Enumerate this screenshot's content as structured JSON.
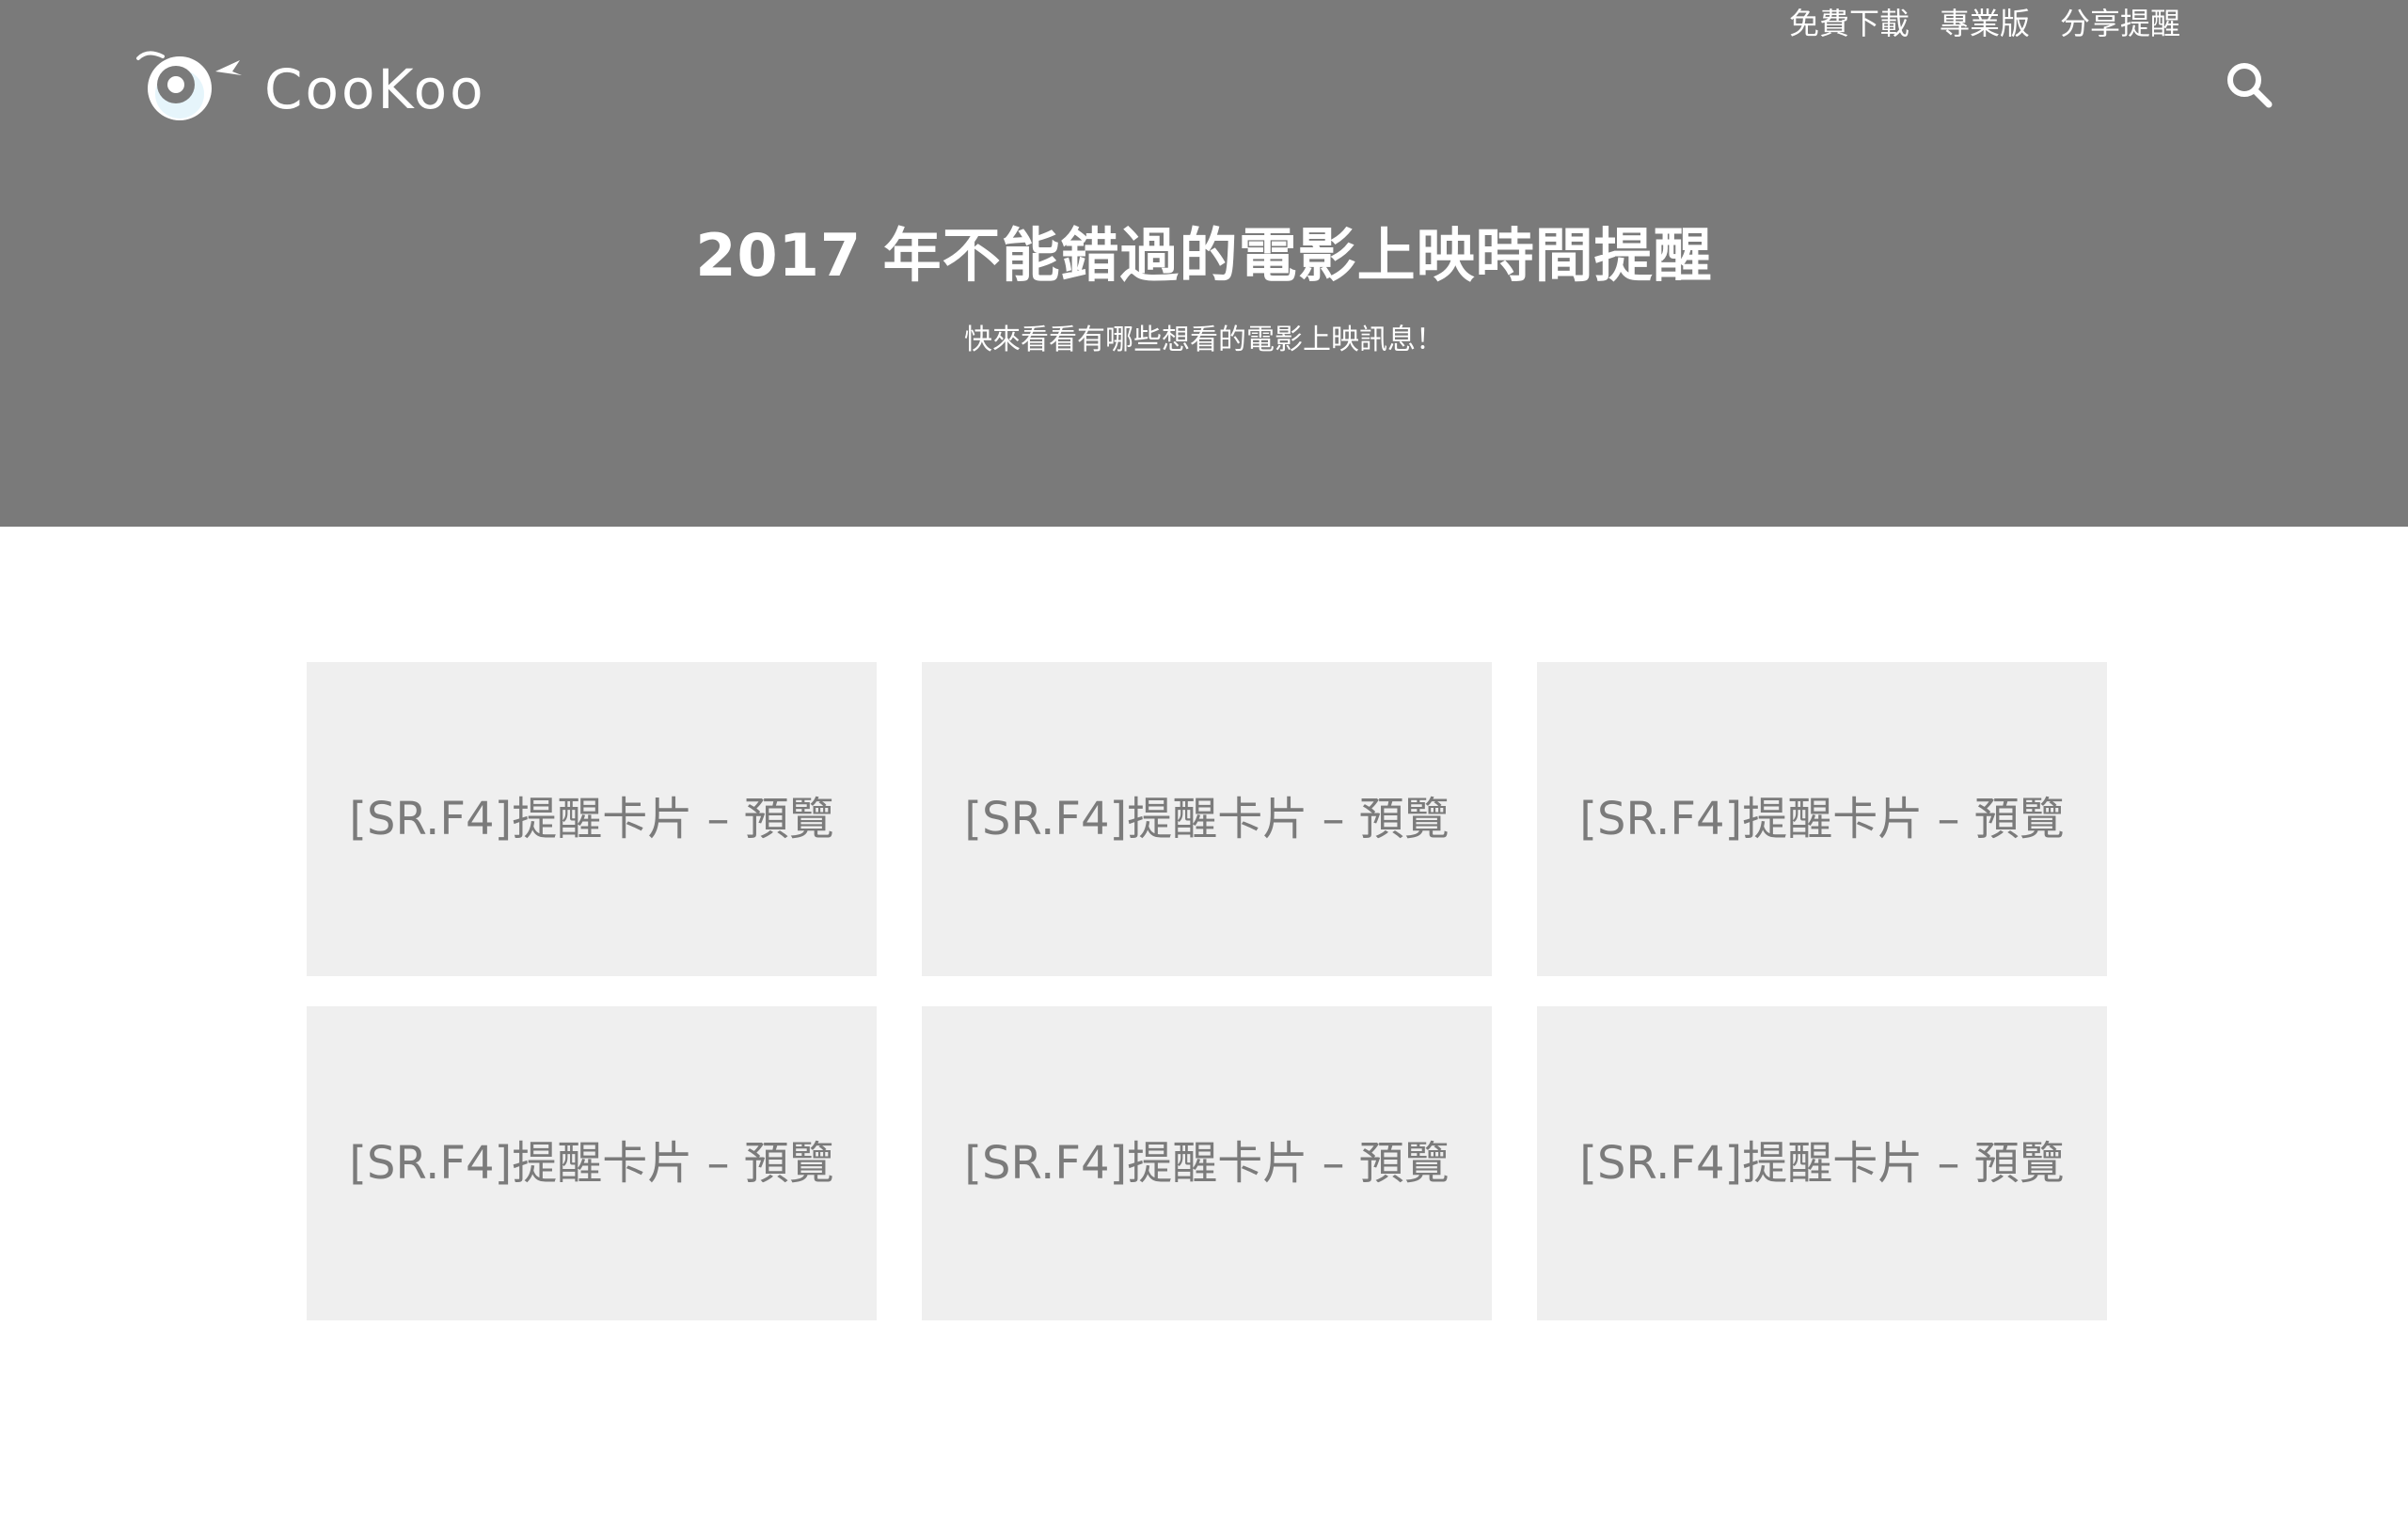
{
  "header": {
    "brand": "CooKoo",
    "nav": [
      {
        "label": "免費下載"
      },
      {
        "label": "專業版"
      },
      {
        "label": "分享提醒"
      }
    ],
    "search_icon": "search-icon"
  },
  "hero": {
    "title": "2017 年不能錯過的電影上映時間提醒",
    "subtitle": "快來看看有哪些想看的電影上映訊息！",
    "background_color": "#7a7a7a"
  },
  "cards": [
    {
      "label": "[SR.F4]提醒卡片 – 預覽"
    },
    {
      "label": "[SR.F4]提醒卡片 – 預覽"
    },
    {
      "label": "[SR.F4]提醒卡片 – 預覽"
    },
    {
      "label": "[SR.F4]提醒卡片 – 預覽"
    },
    {
      "label": "[SR.F4]提醒卡片 – 預覽"
    },
    {
      "label": "[SR.F4]提醒卡片 – 預覽"
    }
  ],
  "colors": {
    "card_background": "#efefef",
    "card_text": "#7b7b7b",
    "accent": "#ffffff"
  }
}
